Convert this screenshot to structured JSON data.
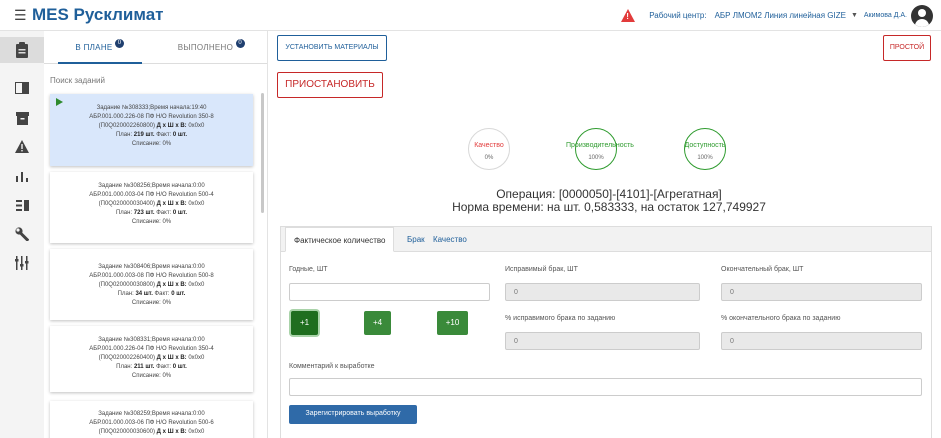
{
  "header": {
    "menu_icon": "hamburger-icon",
    "title": "MES Русклимат",
    "alert_icon": "warning-icon",
    "alert_mark": "!",
    "workcenter_label": "Рабочий центр:",
    "workcenter_value": "АБР ЛМОМ2 Линия линейная GIZE",
    "caret": "▼",
    "user": "Акимова Д.А."
  },
  "sidebar": {
    "items": [
      {
        "icon": "clipboard-icon",
        "active": true
      },
      {
        "icon": "page-icon"
      },
      {
        "icon": "archive-box-icon"
      },
      {
        "icon": "warning-icon"
      },
      {
        "icon": "bar-chart-icon"
      },
      {
        "icon": "list-icon"
      },
      {
        "icon": "wrench-icon"
      },
      {
        "icon": "equalizer-icon"
      }
    ]
  },
  "tasks": {
    "tabs": [
      {
        "label": "В ПЛАНЕ",
        "badge": "0"
      },
      {
        "label": "ВЫПОЛНЕНО",
        "badge": "0"
      }
    ],
    "search_placeholder": "Поиск заданий",
    "cards": [
      {
        "line1": "Задание №308333;Время начала:19:40",
        "line2": "АБР.001.000.226-08 ПФ Н/О Revolution 350-8",
        "line3a": "(П0Q020002260800) ",
        "line3b": "Д x Ш x В:",
        "line3c": " 0x0x0",
        "plan_a": "План: ",
        "plan_b": "219 шт.",
        "plan_c": " Факт: ",
        "plan_d": "0 шт.",
        "line5": "Списание: 0%"
      },
      {
        "line1": "Задание №308256;Время начала:0:00",
        "line2": "АБР.001.000.003-04 ПФ Н/О Revolution 500-4",
        "line3a": "(П0Q020000030400) ",
        "line3b": "Д x Ш x В:",
        "line3c": " 0x0x0",
        "plan_a": "План: ",
        "plan_b": "723 шт.",
        "plan_c": " Факт: ",
        "plan_d": "0 шт.",
        "line5": "Списание: 0%"
      },
      {
        "line1": "Задание №308406;Время начала:0:00",
        "line2": "АБР.001.000.003-08 ПФ Н/О Revolution 500-8",
        "line3a": "(П0Q020000030800) ",
        "line3b": "Д x Ш x В:",
        "line3c": " 0x0x0",
        "plan_a": "План: ",
        "plan_b": "34 шт.",
        "plan_c": " Факт: ",
        "plan_d": "0 шт.",
        "line5": "Списание: 0%"
      },
      {
        "line1": "Задание №308331;Время начала:0:00",
        "line2": "АБР.001.000.226-04 ПФ Н/О Revolution 350-4",
        "line3a": "(П0Q020002260400) ",
        "line3b": "Д x Ш x В:",
        "line3c": " 0x0x0",
        "plan_a": "План: ",
        "plan_b": "211 шт.",
        "plan_c": " Факт: ",
        "plan_d": "0 шт.",
        "line5": "Списание: 0%"
      },
      {
        "line1": "Задание №308259;Время начала:0:00",
        "line2": "АБР.001.000.003-06 ПФ Н/О Revolution 500-6",
        "line3a": "(П0Q020000030600) ",
        "line3b": "Д x Ш x В:",
        "line3c": " 0x0x0"
      }
    ]
  },
  "main": {
    "set_materials": "УСТАНОВИТЬ МАТЕРИАЛЫ",
    "downtime": "ПРОСТОЙ",
    "suspend": "ПРИОСТАНОВИТЬ",
    "kpis": [
      {
        "label": "Качество",
        "value": "0%",
        "color": "#e23b3b",
        "percent": 0
      },
      {
        "label": "Производительность",
        "value": "100%",
        "color": "#2e9b2e",
        "percent": 100
      },
      {
        "label": "Доступность",
        "value": "100%",
        "color": "#2e9b2e",
        "percent": 100
      }
    ],
    "operation": "Операция: [0000050]-[4101]-[Агрегатная]",
    "norm": "Норма времени: на шт. 0,583333, на остаток 127,749927",
    "panel_tabs": [
      "Фактическое количество",
      "Брак",
      "Качество"
    ],
    "good_label": "Годные, ШТ",
    "good_value": "",
    "fixable_label": "Исправимый брак, ШТ",
    "fixable_value": "0",
    "final_label": "Окончательный брак, ШТ",
    "final_value": "0",
    "inc_buttons": [
      "+1",
      "+4",
      "+10"
    ],
    "pct_fixable_label": "% исправимого брака по заданию",
    "pct_fixable_value": "0",
    "pct_final_label": "% окончательного брака по заданию",
    "pct_final_value": "0",
    "comment_label": "Комментарий к выработке",
    "comment_value": "",
    "register": "Зарегистрировать выработку"
  }
}
